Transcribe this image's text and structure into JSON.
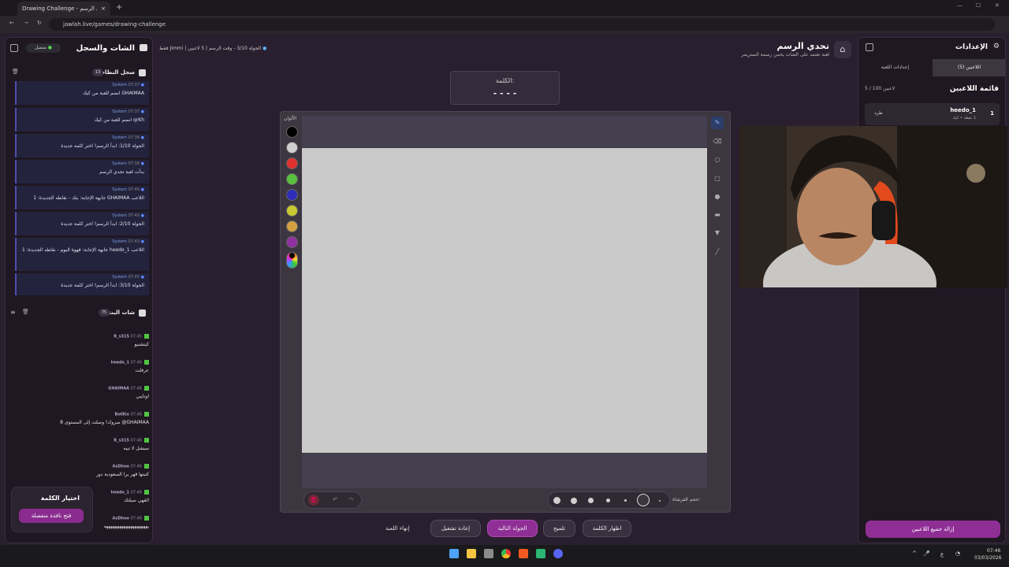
{
  "browser": {
    "tab_title": "Drawing Challenge - تحدي الرسم",
    "url": "jawlah.live/games/drawing-challenge"
  },
  "left": {
    "title": "الشات والسجل",
    "status": "متصل",
    "log_title": "سجل النظام",
    "log_count": "13",
    "sys": "System",
    "log": [
      {
        "time": "07:37",
        "text": "GHAIMAA انضم للعبة من كيك"
      },
      {
        "time": "07:37",
        "text": "qrKh انضم للعبة من كيك"
      },
      {
        "time": "07:38",
        "text": "الجولة 1/10: ابدأ الرسم! اختر كلمة جديدة"
      },
      {
        "time": "07:38",
        "text": "بدأت لعبة تحدي الرسم"
      },
      {
        "time": "07:40",
        "text": "اللاعب GHAIMAA جابهة الإجابة: بنك - نقاطه الجديدة: 1"
      },
      {
        "time": "07:40",
        "text": "الجولة 2/10: ابدأ الرسم! اختر كلمة جديدة"
      },
      {
        "time": "07:43",
        "text": "اللاعب heedo_1 جابهة الإجابة: قهوة اليوم - نقاطه الجديدة: 1"
      },
      {
        "time": "07:45",
        "text": "الجولة 3/10: ابدأ الرسم! اختر كلمة جديدة"
      }
    ],
    "chat_title": "شات البث",
    "chat_count": "75",
    "chat": [
      {
        "time": "07:45",
        "user": "R_s315",
        "text": "كيتشنيو"
      },
      {
        "time": "07:46",
        "user": "heedo_1",
        "text": "عرفلت"
      },
      {
        "time": "07:46",
        "user": "GHAIMAA",
        "text": "اوتايبي"
      },
      {
        "time": "07:46",
        "user": "BotRix",
        "text": "GHAIMAA@ مبروك! وصلت إلى المستوى 8"
      },
      {
        "time": "07:46",
        "user": "R_s315",
        "text": "سيشل لا تبيه"
      },
      {
        "time": "07:46",
        "user": "AsDhoo",
        "text": "كتبتها قهر يرا السعودية دور"
      },
      {
        "time": "07:46",
        "user": "heedo_1",
        "text": "القهي سيلنك"
      },
      {
        "time": "07:46",
        "user": "AsDhoo",
        "text": "يهههههههههههههههههههه"
      }
    ],
    "pick_title": "اختيار الكلمة",
    "pick_button": "فتح نافذة منفصلة"
  },
  "header": {
    "title": "تحدي الرسم",
    "subtitle": "لعبة تعتمد على الشات يخمن رسمة الستريمر",
    "players": "5 لاعبين",
    "round": "الجولة 3/10 - وقت الرسم",
    "timer": "فقط Jimmi"
  },
  "word": {
    "label": "الكلمة:",
    "mask": "- - - -"
  },
  "canvas": {
    "colors_label": "الألوان",
    "brush_label": "حجم الفرشاة:",
    "colors": [
      "#000000",
      "#d0d0d0",
      "#e03030",
      "#5ac040",
      "#2d2db8",
      "#c8c830",
      "#d4a040",
      "#9030a0"
    ]
  },
  "buttons": {
    "show": "اظهار الكلمة",
    "hint": "تلميح",
    "next": "الجولة التالية",
    "restart": "إعادة تشغيل",
    "end": "إنهاء اللعبة"
  },
  "right": {
    "title": "الإعدادات",
    "tab_players": "اللاعبين (5)",
    "tab_settings": "إعدادات اللعبة",
    "list_title": "قائمة اللاعبين",
    "count": "5 / 100 لاعبين",
    "player_rank": "1",
    "player_name": "heedo_1",
    "player_meta": "1 نقطة • كيك",
    "kick": "طرد",
    "remove_all": "إزالة جميع اللاعبين"
  },
  "taskbar": {
    "time": "07:46",
    "date": "03/03/2026",
    "lang": "ع"
  }
}
